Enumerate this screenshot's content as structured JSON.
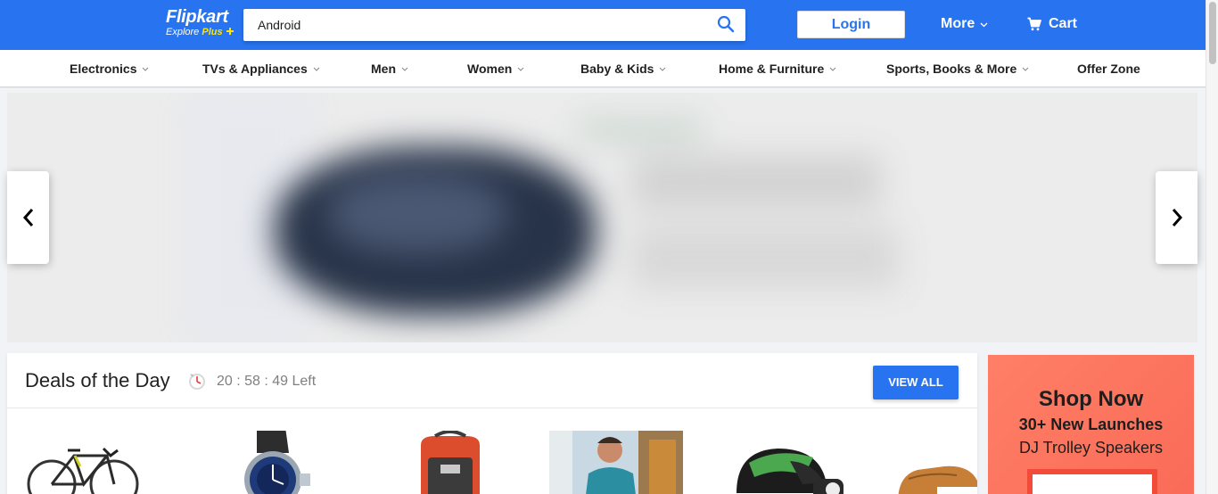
{
  "header": {
    "logo_text": "Flipkart",
    "logo_sub_text": "Explore",
    "logo_sub_plus": "Plus",
    "search_value": "Android",
    "search_icon": "search-icon",
    "login_label": "Login",
    "more_label": "More",
    "cart_label": "Cart",
    "cart_icon": "cart-icon",
    "brand_color": "#2874f0",
    "accent_color": "#ffe500"
  },
  "nav": {
    "items": [
      {
        "label": "Electronics",
        "has_dropdown": true
      },
      {
        "label": "TVs & Appliances",
        "has_dropdown": true
      },
      {
        "label": "Men",
        "has_dropdown": true
      },
      {
        "label": "Women",
        "has_dropdown": true
      },
      {
        "label": "Baby & Kids",
        "has_dropdown": true
      },
      {
        "label": "Home & Furniture",
        "has_dropdown": true
      },
      {
        "label": "Sports, Books & More",
        "has_dropdown": true
      },
      {
        "label": "Offer Zone",
        "has_dropdown": false
      }
    ]
  },
  "banner": {
    "prev_icon": "chevron-left-icon",
    "next_icon": "chevron-right-icon"
  },
  "deals": {
    "title": "Deals of the Day",
    "timer_icon": "stopwatch-icon",
    "timer_text": "20 : 58 : 49 Left",
    "view_all_label": "VIEW ALL",
    "products": [
      {
        "name": "bicycle"
      },
      {
        "name": "wristwatch"
      },
      {
        "name": "backpack"
      },
      {
        "name": "mens-tshirt"
      },
      {
        "name": "helmet"
      },
      {
        "name": "shoes"
      }
    ]
  },
  "ad": {
    "title": "Shop Now",
    "line1": "30+ New Launches",
    "line2": "DJ Trolley Speakers",
    "background_color": "#fa6b57"
  }
}
